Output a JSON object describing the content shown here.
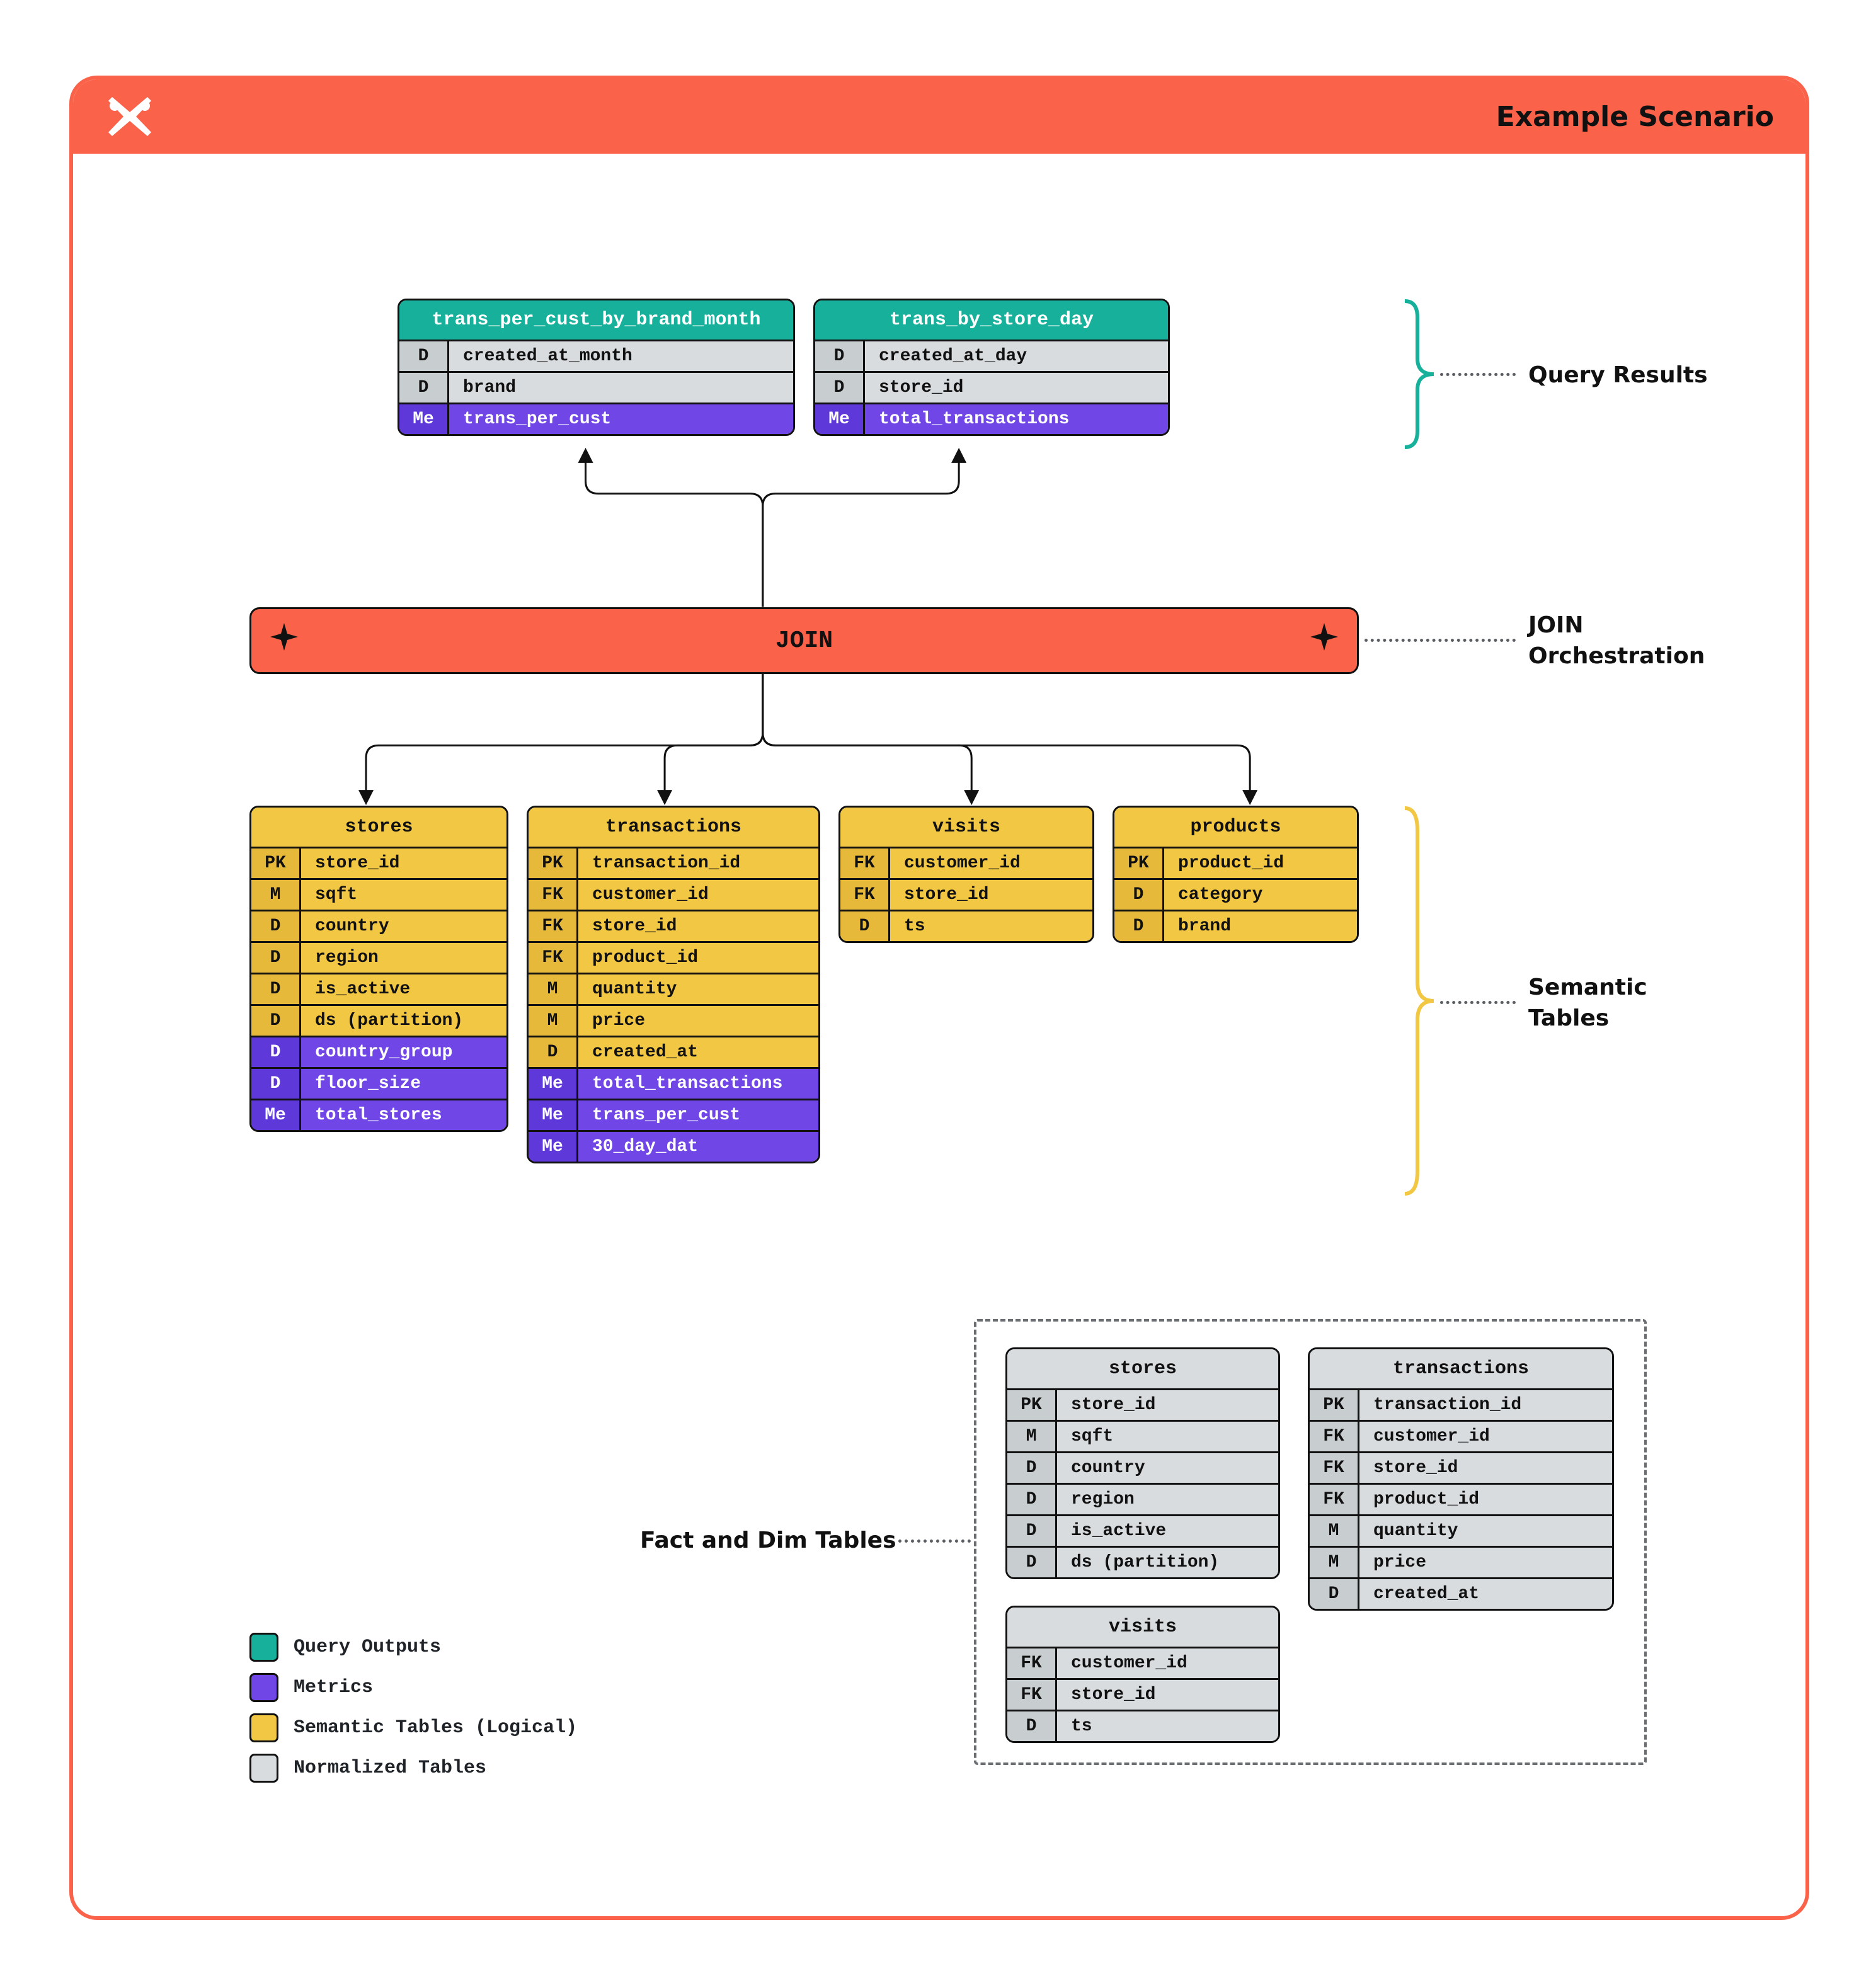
{
  "header": {
    "title": "Example Scenario"
  },
  "labels": {
    "query_results": "Query Results",
    "join_orch": "JOIN\nOrchestration",
    "semantic_tables": "Semantic\nTables",
    "fact_dim": "Fact and Dim Tables"
  },
  "joinbar": {
    "text": "JOIN"
  },
  "legend": [
    {
      "color": "teal",
      "label": "Query Outputs"
    },
    {
      "color": "purple",
      "label": "Metrics"
    },
    {
      "color": "yellow",
      "label": "Semantic Tables (Logical)"
    },
    {
      "color": "grey",
      "label": "Normalized Tables"
    }
  ],
  "query_tables": [
    {
      "title": "trans_per_cust_by_brand_month",
      "dims": [
        {
          "tag": "D",
          "val": "created_at_month"
        },
        {
          "tag": "D",
          "val": "brand"
        }
      ],
      "metrics": [
        {
          "tag": "Me",
          "val": "trans_per_cust"
        }
      ]
    },
    {
      "title": "trans_by_store_day",
      "dims": [
        {
          "tag": "D",
          "val": "created_at_day"
        },
        {
          "tag": "D",
          "val": "store_id"
        }
      ],
      "metrics": [
        {
          "tag": "Me",
          "val": "total_transactions"
        }
      ]
    }
  ],
  "semantic_tables": [
    {
      "title": "stores",
      "base": [
        {
          "tag": "PK",
          "val": "store_id"
        },
        {
          "tag": "M",
          "val": "sqft"
        },
        {
          "tag": "D",
          "val": "country"
        },
        {
          "tag": "D",
          "val": "region"
        },
        {
          "tag": "D",
          "val": "is_active"
        },
        {
          "tag": "D",
          "val": "ds (partition)"
        }
      ],
      "derived": [
        {
          "tag": "D",
          "val": "country_group"
        },
        {
          "tag": "D",
          "val": "floor_size"
        },
        {
          "tag": "Me",
          "val": "total_stores"
        }
      ]
    },
    {
      "title": "transactions",
      "base": [
        {
          "tag": "PK",
          "val": "transaction_id"
        },
        {
          "tag": "FK",
          "val": "customer_id"
        },
        {
          "tag": "FK",
          "val": "store_id"
        },
        {
          "tag": "FK",
          "val": "product_id"
        },
        {
          "tag": "M",
          "val": "quantity"
        },
        {
          "tag": "M",
          "val": "price"
        },
        {
          "tag": "D",
          "val": "created_at"
        }
      ],
      "derived": [
        {
          "tag": "Me",
          "val": "total_transactions"
        },
        {
          "tag": "Me",
          "val": "trans_per_cust"
        },
        {
          "tag": "Me",
          "val": "30_day_dat"
        }
      ]
    },
    {
      "title": "visits",
      "base": [
        {
          "tag": "FK",
          "val": "customer_id"
        },
        {
          "tag": "FK",
          "val": "store_id"
        },
        {
          "tag": "D",
          "val": "ts"
        }
      ],
      "derived": []
    },
    {
      "title": "products",
      "base": [
        {
          "tag": "PK",
          "val": "product_id"
        },
        {
          "tag": "D",
          "val": "category"
        },
        {
          "tag": "D",
          "val": "brand"
        }
      ],
      "derived": []
    }
  ],
  "fact_tables": [
    {
      "title": "stores",
      "rows": [
        {
          "tag": "PK",
          "val": "store_id"
        },
        {
          "tag": "M",
          "val": "sqft"
        },
        {
          "tag": "D",
          "val": "country"
        },
        {
          "tag": "D",
          "val": "region"
        },
        {
          "tag": "D",
          "val": "is_active"
        },
        {
          "tag": "D",
          "val": "ds (partition)"
        }
      ]
    },
    {
      "title": "transactions",
      "rows": [
        {
          "tag": "PK",
          "val": "transaction_id"
        },
        {
          "tag": "FK",
          "val": "customer_id"
        },
        {
          "tag": "FK",
          "val": "store_id"
        },
        {
          "tag": "FK",
          "val": "product_id"
        },
        {
          "tag": "M",
          "val": "quantity"
        },
        {
          "tag": "M",
          "val": "price"
        },
        {
          "tag": "D",
          "val": "created_at"
        }
      ]
    },
    {
      "title": "visits",
      "rows": [
        {
          "tag": "FK",
          "val": "customer_id"
        },
        {
          "tag": "FK",
          "val": "store_id"
        },
        {
          "tag": "D",
          "val": "ts"
        }
      ]
    }
  ]
}
